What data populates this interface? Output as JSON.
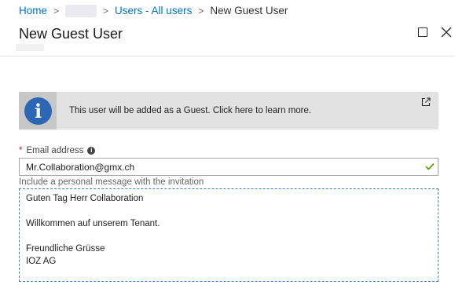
{
  "breadcrumb": {
    "home": "Home",
    "users": "Users - All users",
    "current": "New Guest User"
  },
  "blade": {
    "title": "New Guest User"
  },
  "info": {
    "glyph": "i",
    "text": "This user will be added as a Guest. Click here to learn more."
  },
  "form": {
    "required_mark": "*",
    "email_label": "Email address",
    "help_glyph": "i",
    "email_value": "Mr.Collaboration@gmx.ch",
    "message_label": "Include a personal message with the invitation",
    "message_lines": [
      "Guten Tag Herr Collaboration",
      "",
      "Willkommen auf unserem Tenant.",
      "",
      "Freundliche Grüsse",
      "IOZ AG"
    ]
  },
  "colors": {
    "link": "#0072c6",
    "info_circle": "#2c67b5",
    "valid": "#57a300",
    "required": "#a4262c"
  },
  "icons": {
    "breadcrumb_separator": "chevron-right-icon",
    "maximize": "maximize-icon",
    "close": "close-icon",
    "info": "info-icon",
    "external_link": "external-link-icon",
    "help": "help-icon",
    "valid": "checkmark-icon"
  }
}
